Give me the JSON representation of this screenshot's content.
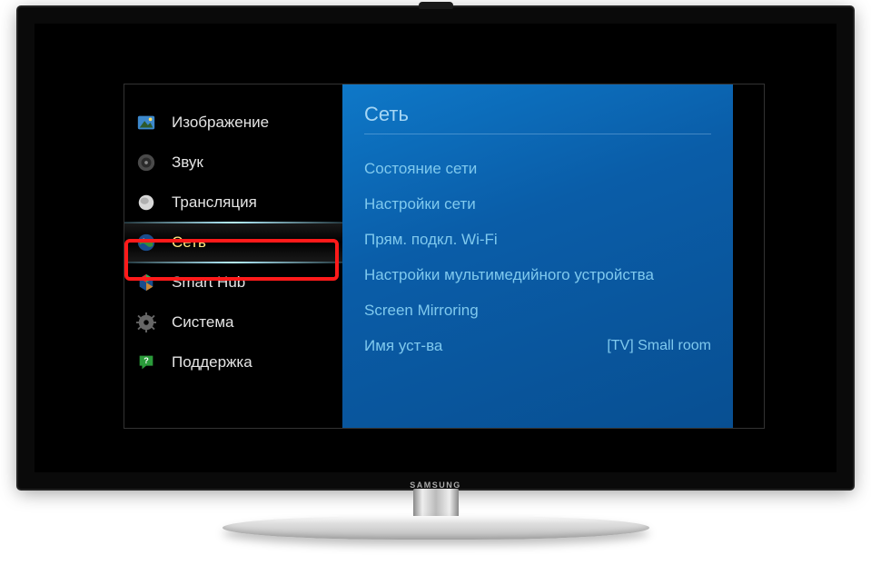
{
  "sidebar": {
    "items": [
      {
        "label": "Изображение"
      },
      {
        "label": "Звук"
      },
      {
        "label": "Трансляция"
      },
      {
        "label": "Сеть"
      },
      {
        "label": "Smart Hub"
      },
      {
        "label": "Система"
      },
      {
        "label": "Поддержка"
      }
    ]
  },
  "panel": {
    "title": "Сеть",
    "items": [
      {
        "label": "Состояние сети",
        "value": ""
      },
      {
        "label": "Настройки сети",
        "value": ""
      },
      {
        "label": "Прям. подкл. Wi-Fi",
        "value": ""
      },
      {
        "label": "Настройки мультимедийного устройства",
        "value": ""
      },
      {
        "label": "Screen Mirroring",
        "value": ""
      },
      {
        "label": "Имя уст-ва",
        "value": "[TV] Small room"
      }
    ]
  },
  "brand": "SAMSUNG"
}
